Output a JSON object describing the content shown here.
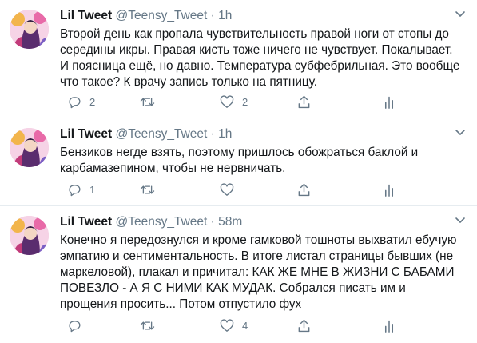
{
  "tweets": [
    {
      "name": "Lil Tweet",
      "handle": "@Teensy_Tweet",
      "separator": "·",
      "time": "1h",
      "lines": [
        "Второй день как пропала чувствительность правой ноги от стопы до",
        "середины икры. Правая кисть тоже ничего не чувствует. Покалывает.",
        "И поясница ещё, но давно. Температура субфебрильная. Это вообще",
        "что такое? К врачу запись только на пятницу."
      ],
      "reply_count": "2",
      "retweet_count": "",
      "like_count": "2"
    },
    {
      "name": "Lil Tweet",
      "handle": "@Teensy_Tweet",
      "separator": "·",
      "time": "1h",
      "lines": [
        "Бензиков негде взять, поэтому пришлось обожраться баклой и",
        "карбамазепином, чтобы не нервничать."
      ],
      "reply_count": "1",
      "retweet_count": "",
      "like_count": ""
    },
    {
      "name": "Lil Tweet",
      "handle": "@Teensy_Tweet",
      "separator": "·",
      "time": "58m",
      "lines": [
        "Конечно я передознулся и кроме гамковой тошноты выхватил ебучую",
        "эмпатию и сентиментальность. В итоге листал страницы бывших (не",
        "маркеловой), плакал и причитал: КАК ЖЕ МНЕ В ЖИЗНИ С БАБАМИ",
        "ПОВЕЗЛО - А Я С НИМИ КАК МУДАК. Собрался писать им и",
        "прощения просить... Потом отпустило фух"
      ],
      "reply_count": "",
      "retweet_count": "",
      "like_count": "4"
    }
  ],
  "icons": {
    "reply": "reply-icon",
    "retweet": "retweet-icon",
    "like": "like-icon",
    "share": "share-icon",
    "analytics": "analytics-icon",
    "more": "chevron-down-icon"
  },
  "colors": {
    "icon": "#657786",
    "text": "#14171a",
    "divider": "#e6ecf0"
  }
}
